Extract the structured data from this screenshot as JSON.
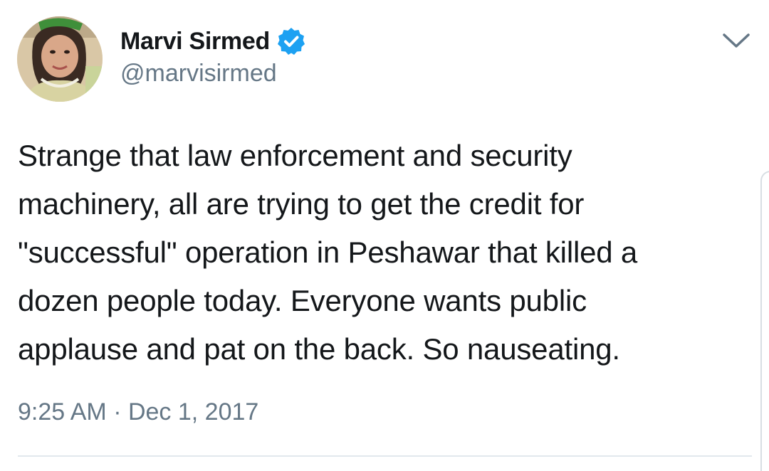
{
  "user": {
    "display_name": "Marvi Sirmed",
    "handle": "@marvisirmed",
    "verified": true
  },
  "tweet": {
    "text": "Strange that law enforcement and security\nmachinery, all are trying to get the credit for\n\"successful\" operation in Peshawar that killed a\ndozen people today. Everyone wants public\napplause and pat on the back. So nauseating.",
    "timestamp": "9:25 AM · Dec 1, 2017"
  },
  "icons": {
    "verified": "verified-badge-icon",
    "menu": "chevron-down-icon",
    "avatar": "profile-photo"
  },
  "colors": {
    "primary_text": "#14171a",
    "secondary_text": "#657786",
    "verified_blue": "#1da1f2",
    "divider": "#e1e8ed"
  }
}
